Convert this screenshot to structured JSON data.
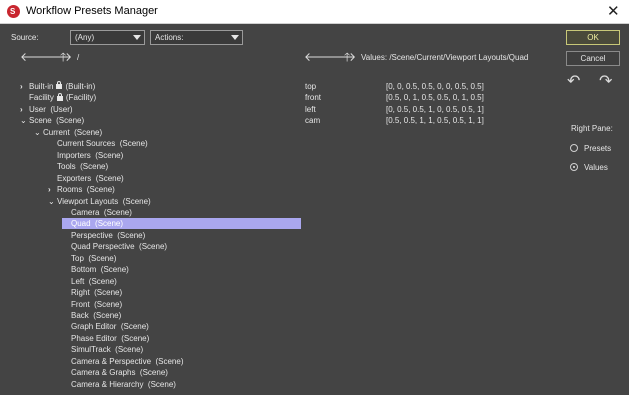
{
  "window": {
    "title": "Workflow Presets Manager",
    "close_glyph": "✕"
  },
  "toolbar": {
    "source_label": "Source:",
    "source_value": "(Any)",
    "actions_value": "Actions:",
    "left_path": "/",
    "values_path": "Values: /Scene/Current/Viewport Layouts/Quad"
  },
  "icons": {
    "back": "🡐",
    "forward": "🡒",
    "up": "🡑",
    "undo": "↶",
    "redo": "↷",
    "collapsed": "›",
    "expanded": "⌄"
  },
  "tree": [
    {
      "name": "Built-in",
      "tag": "(Built-in)",
      "depth": 0,
      "expander": ">",
      "locked": true,
      "selected": false
    },
    {
      "name": "Facility",
      "tag": "(Facility)",
      "depth": 0,
      "expander": "",
      "locked": true,
      "selected": false
    },
    {
      "name": "User",
      "tag": "(User)",
      "depth": 0,
      "expander": ">",
      "locked": false,
      "selected": false
    },
    {
      "name": "Scene",
      "tag": "(Scene)",
      "depth": 0,
      "expander": "v",
      "locked": false,
      "selected": false
    },
    {
      "name": "Current",
      "tag": "(Scene)",
      "depth": 1,
      "expander": "v",
      "locked": false,
      "selected": false
    },
    {
      "name": "Current Sources",
      "tag": "(Scene)",
      "depth": 2,
      "expander": "",
      "locked": false,
      "selected": false
    },
    {
      "name": "Importers",
      "tag": "(Scene)",
      "depth": 2,
      "expander": "",
      "locked": false,
      "selected": false
    },
    {
      "name": "Tools",
      "tag": "(Scene)",
      "depth": 2,
      "expander": "",
      "locked": false,
      "selected": false
    },
    {
      "name": "Exporters",
      "tag": "(Scene)",
      "depth": 2,
      "expander": "",
      "locked": false,
      "selected": false
    },
    {
      "name": "Rooms",
      "tag": "(Scene)",
      "depth": 2,
      "expander": ">",
      "locked": false,
      "selected": false
    },
    {
      "name": "Viewport Layouts",
      "tag": "(Scene)",
      "depth": 2,
      "expander": "v",
      "locked": false,
      "selected": false
    },
    {
      "name": "Camera",
      "tag": "(Scene)",
      "depth": 3,
      "expander": "",
      "locked": false,
      "selected": false
    },
    {
      "name": "Quad",
      "tag": "(Scene)",
      "depth": 3,
      "expander": "",
      "locked": false,
      "selected": true
    },
    {
      "name": "Perspective",
      "tag": "(Scene)",
      "depth": 3,
      "expander": "",
      "locked": false,
      "selected": false
    },
    {
      "name": "Quad Perspective",
      "tag": "(Scene)",
      "depth": 3,
      "expander": "",
      "locked": false,
      "selected": false
    },
    {
      "name": "Top",
      "tag": "(Scene)",
      "depth": 3,
      "expander": "",
      "locked": false,
      "selected": false
    },
    {
      "name": "Bottom",
      "tag": "(Scene)",
      "depth": 3,
      "expander": "",
      "locked": false,
      "selected": false
    },
    {
      "name": "Left",
      "tag": "(Scene)",
      "depth": 3,
      "expander": "",
      "locked": false,
      "selected": false
    },
    {
      "name": "Right",
      "tag": "(Scene)",
      "depth": 3,
      "expander": "",
      "locked": false,
      "selected": false
    },
    {
      "name": "Front",
      "tag": "(Scene)",
      "depth": 3,
      "expander": "",
      "locked": false,
      "selected": false
    },
    {
      "name": "Back",
      "tag": "(Scene)",
      "depth": 3,
      "expander": "",
      "locked": false,
      "selected": false
    },
    {
      "name": "Graph Editor",
      "tag": "(Scene)",
      "depth": 3,
      "expander": "",
      "locked": false,
      "selected": false
    },
    {
      "name": "Phase Editor",
      "tag": "(Scene)",
      "depth": 3,
      "expander": "",
      "locked": false,
      "selected": false
    },
    {
      "name": "SimulTrack",
      "tag": "(Scene)",
      "depth": 3,
      "expander": "",
      "locked": false,
      "selected": false
    },
    {
      "name": "Camera & Perspective",
      "tag": "(Scene)",
      "depth": 3,
      "expander": "",
      "locked": false,
      "selected": false
    },
    {
      "name": "Camera & Graphs",
      "tag": "(Scene)",
      "depth": 3,
      "expander": "",
      "locked": false,
      "selected": false
    },
    {
      "name": "Camera & Hierarchy",
      "tag": "(Scene)",
      "depth": 3,
      "expander": "",
      "locked": false,
      "selected": false
    }
  ],
  "values": [
    {
      "key": "top",
      "value": "[0, 0, 0.5, 0.5, 0, 0, 0.5, 0.5]"
    },
    {
      "key": "front",
      "value": "[0.5, 0, 1, 0.5, 0.5, 0, 1, 0.5]"
    },
    {
      "key": "left",
      "value": "[0, 0.5, 0.5, 1, 0, 0.5, 0.5, 1]"
    },
    {
      "key": "cam",
      "value": "[0.5, 0.5, 1, 1, 0.5, 0.5, 1, 1]"
    }
  ],
  "buttons": {
    "ok": "OK",
    "cancel": "Cancel"
  },
  "right_pane": {
    "label": "Right Pane:",
    "options": [
      "Presets",
      "Values"
    ],
    "selected": "Values"
  }
}
